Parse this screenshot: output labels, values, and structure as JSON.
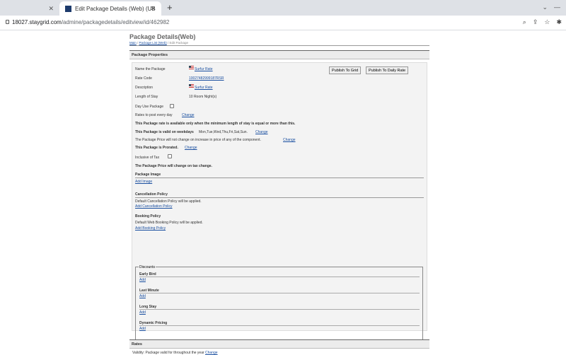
{
  "browser": {
    "inactive_tab_title": "18027.staygrid.com/admine/packagedetails/editview/id/462982",
    "inactive_tab_short": "",
    "active_tab_title": "Edit Package Details (Web) (UB",
    "url_host": "18027.staygrid.com",
    "url_path": "/admine/packagedetails/editview/id/462982"
  },
  "page": {
    "title": "Package Details(Web)",
    "breadcrumb": [
      "Main",
      "Package List (Web)",
      "Edit Package"
    ]
  },
  "properties": {
    "heading": "Package Properties",
    "name_label": "Name the Package",
    "name_value": "Surfur Rate",
    "rate_code_label": "Rate Code",
    "rate_code_value": "10027482999187RSR",
    "description_label": "Description",
    "description_value": "Surfur Rate",
    "length_label": "Length of Stay",
    "length_value": "10 Room Night(s)",
    "publish_grid": "Publish To Grid",
    "publish_daily": "Publish To Daily Rate",
    "day_use_label": "Day Use Package",
    "rates_every_day": "Rates to post every day",
    "change": "Change",
    "min_stay_text": "This Package rate is available only when the minimum length of stay is equal or more than this.",
    "weekdays_prefix": "This Package is valid on weekdays",
    "weekdays_value": "Mon,Tue,Wed,Thu,Fri,Sat,Sun.",
    "price_no_change": "The Package Price will not change on increase in price of any of the component.",
    "prorated": "This Package is Prorated.",
    "inclusive_tax": "Inclusive of Tax",
    "price_tax_change": "The Package Price will change on tax change.",
    "package_image_h": "Package Image",
    "add_image": "Add Image",
    "cancel_h": "Cancellation Policy",
    "cancel_text": "Default Cancellation Policy will be applied.",
    "add_cancel": "Add Cancellation Policy",
    "booking_h": "Booking Policy",
    "booking_text": "Default Web Booking Policy will be applied.",
    "add_booking": "Add Booking Policy",
    "discounts_h": "Discounts",
    "discounts": [
      {
        "label": "Early Bird",
        "add": "Add"
      },
      {
        "label": "Last Minute",
        "add": "Add"
      },
      {
        "label": "Long Stay",
        "add": "Add"
      },
      {
        "label": "Dynamic Pricing",
        "add": "Add"
      }
    ]
  },
  "rates": {
    "heading": "Rates",
    "validity_prefix": "Validity:",
    "validity_text": "Package valid for throughout the year",
    "change": "Change"
  }
}
